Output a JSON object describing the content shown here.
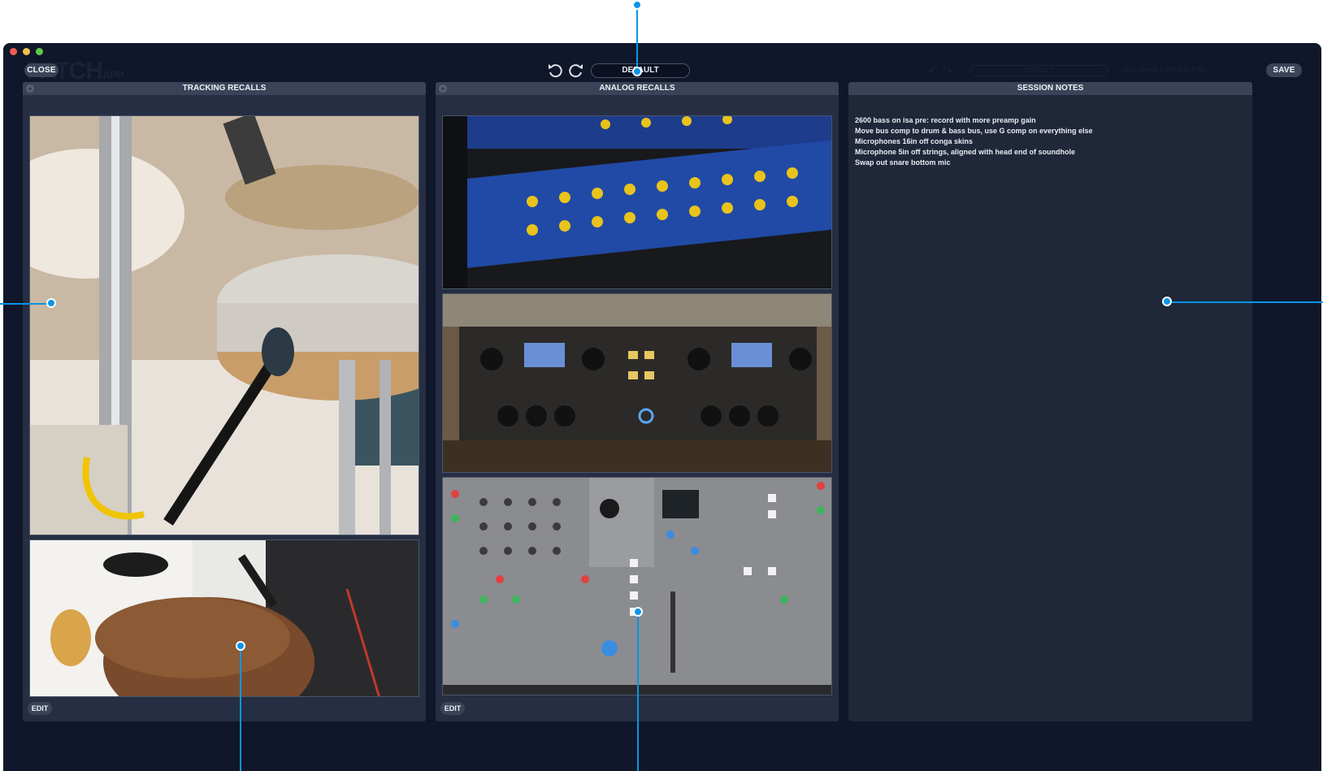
{
  "window": {
    "close_label": "CLOSE",
    "save_label": "SAVE",
    "preset_value": "DEFAULT",
    "ghost_logo": "PATCH",
    "ghost_logo_suffix": "APP",
    "ghost_preset": "DEFAULT",
    "ghost_menu": "NEW   SAVE   EDIT   DELETE"
  },
  "panels": {
    "tracking": {
      "title": "TRACKING RECALLS",
      "edit_label": "EDIT"
    },
    "analog": {
      "title": "ANALOG RECALLS",
      "edit_label": "EDIT"
    },
    "notes": {
      "title": "SESSION NOTES",
      "lines": [
        "2600 bass on isa pre: record with more preamp gain",
        "Move bus comp to drum & bass bus, use G comp on everything else",
        "Microphones 16in off conga skins",
        "Microphone 5in off strings, aligned with head end of soundhole",
        "Swap out snare bottom mic"
      ]
    }
  },
  "colors": {
    "window_bg": "#10172a",
    "panel_bg": "#252e42",
    "header_bg": "#3a4357",
    "accent": "#0a95e8"
  },
  "icons": [
    "undo-icon",
    "redo-icon",
    "plus-icon"
  ]
}
